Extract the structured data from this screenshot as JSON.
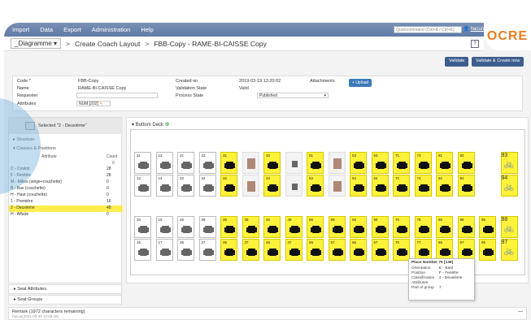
{
  "nav": {
    "menus": [
      "Import",
      "Data",
      "Export",
      "Administration",
      "Help"
    ],
    "quick_command": "Quickcommand (Ctrl+& / Ctrl+K)",
    "user": "hacun",
    "logo": "OCRE"
  },
  "titlebar": {
    "diagram_select": "_Diagramme",
    "crumbs": [
      "Create Coach Layout",
      "FBB-Copy - RAME-BI-CAISSE Copy"
    ],
    "help": "?"
  },
  "actions": {
    "validate": "Validate",
    "validate_create": "Validate & Create new"
  },
  "form": {
    "code_label": "Code *",
    "code_value": "FBB-Copy",
    "name_label": "Name",
    "name_value": "RAME-BI-CAISSE Copy",
    "requester_label": "Requester",
    "requester_value": "",
    "attributes_label": "Attributes",
    "attributes_value": "NUM [202]",
    "created_on_label": "Created on",
    "created_on_value": "2019-03-19 13:20:02",
    "validation_label": "Validation State",
    "validation_value": "Valid",
    "process_label": "Process State",
    "process_value": "Published",
    "attachments_label": "Attachments",
    "upload_label": "Upload"
  },
  "left": {
    "selected": "Selected \"2 - Deuxième\"",
    "structure": "Structure",
    "classes": "Classes & Positions",
    "col_attribute": "Attribute",
    "col_count": "Count",
    "total": "0",
    "rows": [
      {
        "label": "C - Couloir",
        "count": "28"
      },
      {
        "label": "F - Fenêtre",
        "count": "28"
      },
      {
        "label": "M - Milieu (siège+couchette)",
        "count": "0"
      },
      {
        "label": "B - Bas (couchette)",
        "count": "0"
      },
      {
        "label": "H - Haut (couchette)",
        "count": "0"
      },
      {
        "label": "1 - Première",
        "count": "16"
      },
      {
        "label": "2 - Deuxième",
        "count": "48"
      },
      {
        "label": "H - Affaire",
        "count": "0"
      }
    ],
    "seat_attributes": "Seat Attributes",
    "seat_groups": "Seat Groups"
  },
  "deck": {
    "title": "Bottom Deck",
    "row1": [
      "11",
      "13",
      "21",
      "23",
      "31",
      "",
      "33",
      "",
      "51",
      "",
      "53",
      "63",
      "71",
      "73",
      "81",
      "83",
      "",
      "93"
    ],
    "row2": [
      "12",
      "14",
      "22",
      "24",
      "32",
      "",
      "34",
      "",
      "52",
      "",
      "54",
      "64",
      "72",
      "74",
      "82",
      "84",
      "",
      "94"
    ],
    "row3": [
      "10",
      "18",
      "26",
      "28",
      "36",
      "38",
      "46",
      "48",
      "56",
      "58",
      "66",
      "68",
      "76",
      "78",
      "86",
      "88",
      "96",
      "98"
    ],
    "row4": [
      "15",
      "17",
      "25",
      "27",
      "35",
      "37",
      "45",
      "47",
      "55",
      "57",
      "65",
      "67",
      "75",
      "77",
      "85",
      "87",
      "95",
      "97"
    ]
  },
  "tooltip": {
    "title": "Place Number 75 [136]",
    "orientation_k": "Orientation",
    "orientation_v": "E - East",
    "position_k": "Position",
    "position_v": "F - Fenêtre",
    "class_k": "Classification",
    "class_v": "2 - Deuxième",
    "attributes_k": "Attributes",
    "group_k": "Part of group",
    "group_v": "7"
  },
  "remark": {
    "title": "Remark (1972 characters remaining)",
    "sub": "hacun(2021-03-30 10:59:48)"
  },
  "colors": {
    "accent": "#3d5f8e",
    "highlight": "#ffed4d",
    "seat_yellow": "#fff23a",
    "logo": "#e67e22"
  }
}
